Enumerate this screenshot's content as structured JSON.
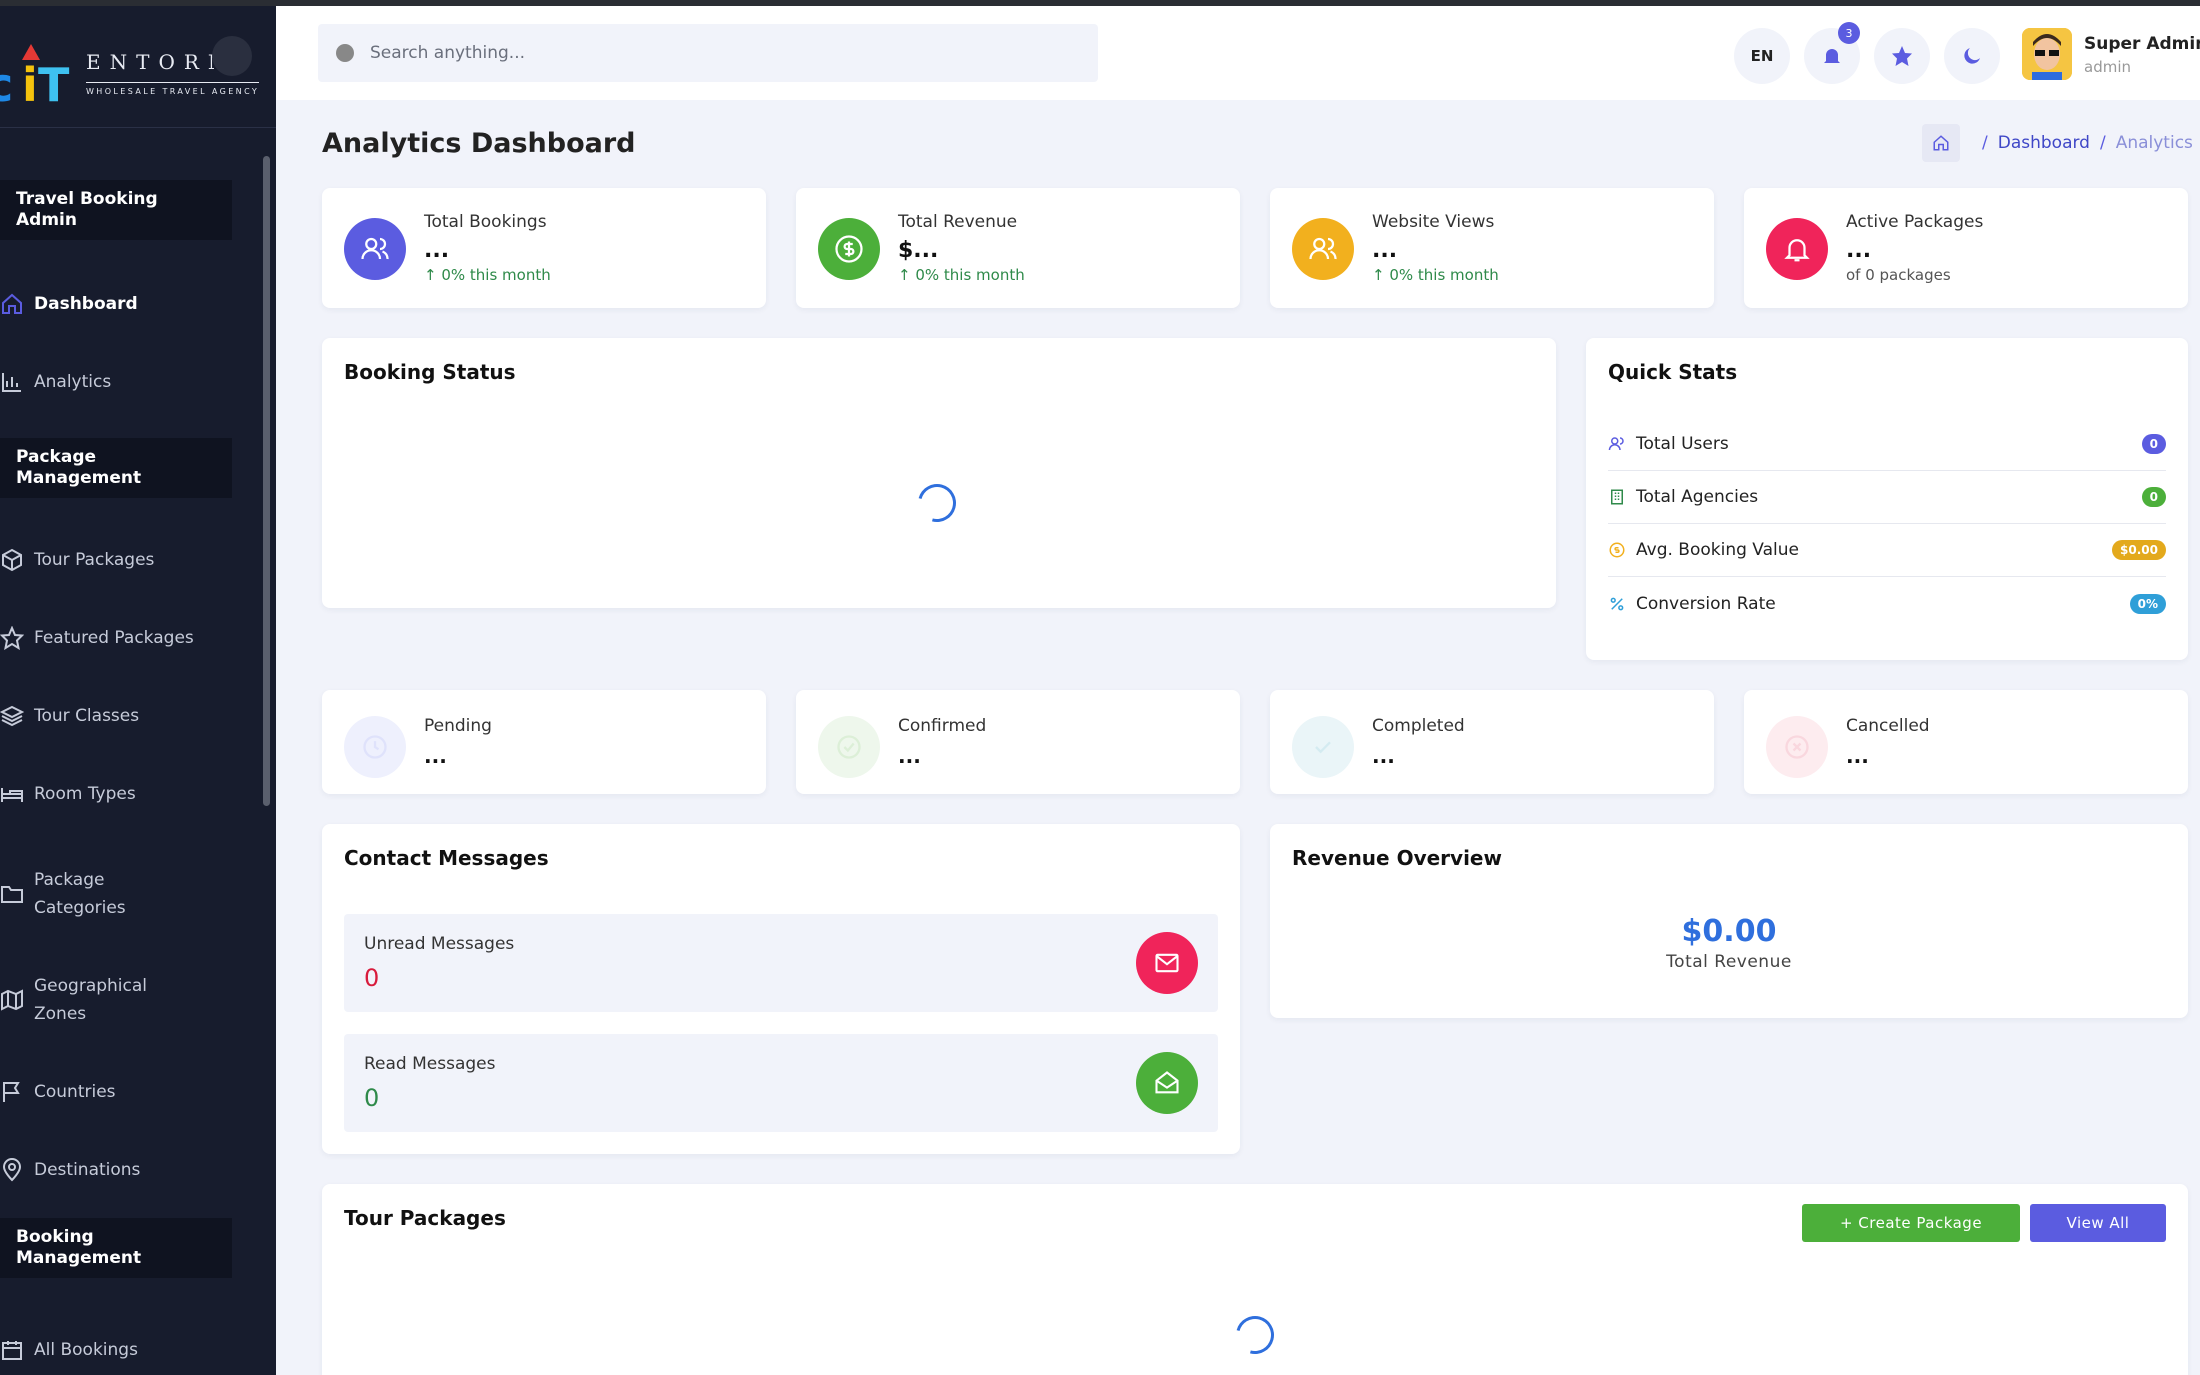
{
  "brand": {
    "name": "ENTORNO",
    "tagline": "WHOLESALE TRAVEL AGENCY"
  },
  "sidebar": {
    "sections": [
      "Travel Booking Admin",
      "Package Management",
      "Booking Management"
    ],
    "items": [
      {
        "label": "Dashboard",
        "icon": "home-icon",
        "active": true
      },
      {
        "label": "Analytics",
        "icon": "bar-chart-icon"
      },
      {
        "label": "Tour Packages",
        "icon": "box-icon"
      },
      {
        "label": "Featured Packages",
        "icon": "star-icon"
      },
      {
        "label": "Tour Classes",
        "icon": "layers-icon"
      },
      {
        "label": "Room Types",
        "icon": "bed-icon"
      },
      {
        "label": "Package Categories",
        "icon": "folder-icon"
      },
      {
        "label": "Geographical Zones",
        "icon": "map-icon"
      },
      {
        "label": "Countries",
        "icon": "flag-icon"
      },
      {
        "label": "Destinations",
        "icon": "map-pin-icon"
      },
      {
        "label": "All Bookings",
        "icon": "calendar-icon"
      }
    ]
  },
  "header": {
    "search_placeholder": "Search anything...",
    "language": "EN",
    "notification_count": "3",
    "user_name": "Super Admin",
    "user_role": "admin"
  },
  "page": {
    "title": "Analytics Dashboard",
    "breadcrumb": [
      "Dashboard",
      "Analytics"
    ]
  },
  "stats": [
    {
      "label": "Total Bookings",
      "value": "...",
      "sub": "↑ 0% this month",
      "color": "#5b5ce0",
      "icon": "users-icon"
    },
    {
      "label": "Total Revenue",
      "value": "$...",
      "sub": "↑ 0% this month",
      "color": "#4caf3a",
      "icon": "dollar-icon"
    },
    {
      "label": "Website Views",
      "value": "...",
      "sub": "↑ 0% this month",
      "color": "#f2b01e",
      "icon": "users-icon"
    },
    {
      "label": "Active Packages",
      "value": "...",
      "sub": "of 0 packages",
      "color": "#f0245a",
      "icon": "bell-icon"
    }
  ],
  "booking_status": {
    "title": "Booking Status"
  },
  "quick_stats": {
    "title": "Quick Stats",
    "rows": [
      {
        "label": "Total Users",
        "value": "0",
        "color": "#5b5ce0",
        "icon": "users-icon"
      },
      {
        "label": "Total Agencies",
        "value": "0",
        "color": "#4caf3a",
        "icon": "building-icon"
      },
      {
        "label": "Avg. Booking Value",
        "value": "$0.00",
        "color": "#f2b01e",
        "icon": "coin-icon"
      },
      {
        "label": "Conversion Rate",
        "value": "0%",
        "color": "#2f9fd8",
        "icon": "percent-icon"
      }
    ]
  },
  "booking_states": [
    {
      "label": "Pending",
      "value": "...",
      "color": "#eef0fd"
    },
    {
      "label": "Confirmed",
      "value": "...",
      "color": "#eef7ec"
    },
    {
      "label": "Completed",
      "value": "...",
      "color": "#eaf5f8"
    },
    {
      "label": "Cancelled",
      "value": "...",
      "color": "#fdecef"
    }
  ],
  "contact_messages": {
    "title": "Contact Messages",
    "unread_label": "Unread Messages",
    "unread_value": "0",
    "read_label": "Read Messages",
    "read_value": "0"
  },
  "revenue_overview": {
    "title": "Revenue Overview",
    "amount": "$0.00",
    "label": "Total Revenue"
  },
  "tour_packages": {
    "title": "Tour Packages",
    "create_label": "+ Create Package",
    "view_all_label": "View All"
  }
}
